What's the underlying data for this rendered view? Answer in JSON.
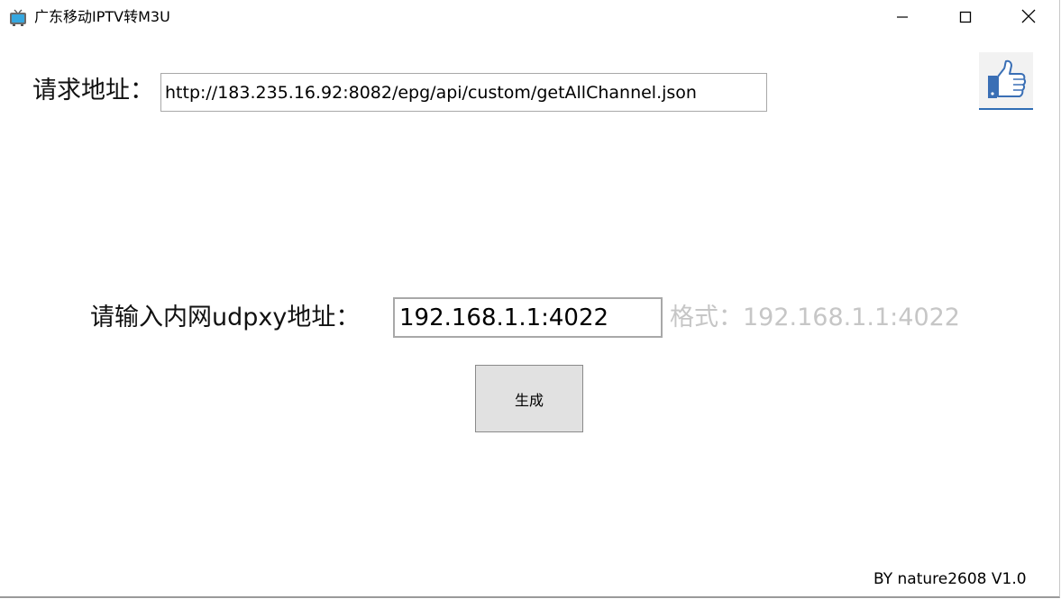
{
  "window": {
    "title": "广东移动IPTV转M3U",
    "app_icon": "tv-icon",
    "controls": {
      "minimize_icon": "minimize-icon",
      "maximize_icon": "maximize-icon",
      "close_icon": "close-icon"
    }
  },
  "request": {
    "label": "请求地址：",
    "url": "http://183.235.16.92:8082/epg/api/custom/getAllChannel.json"
  },
  "udpxy": {
    "label": "请输入内网udpxy地址：",
    "value": "192.168.1.1:4022",
    "hint": "格式：192.168.1.1:4022"
  },
  "actions": {
    "generate_label": "生成",
    "like_icon": "thumbs-up-icon"
  },
  "footer": {
    "version": "BY nature2608 V1.0"
  },
  "colors": {
    "accent": "#2f6db5",
    "hint_text": "#c6c6c6",
    "button_bg": "#e1e1e1"
  }
}
